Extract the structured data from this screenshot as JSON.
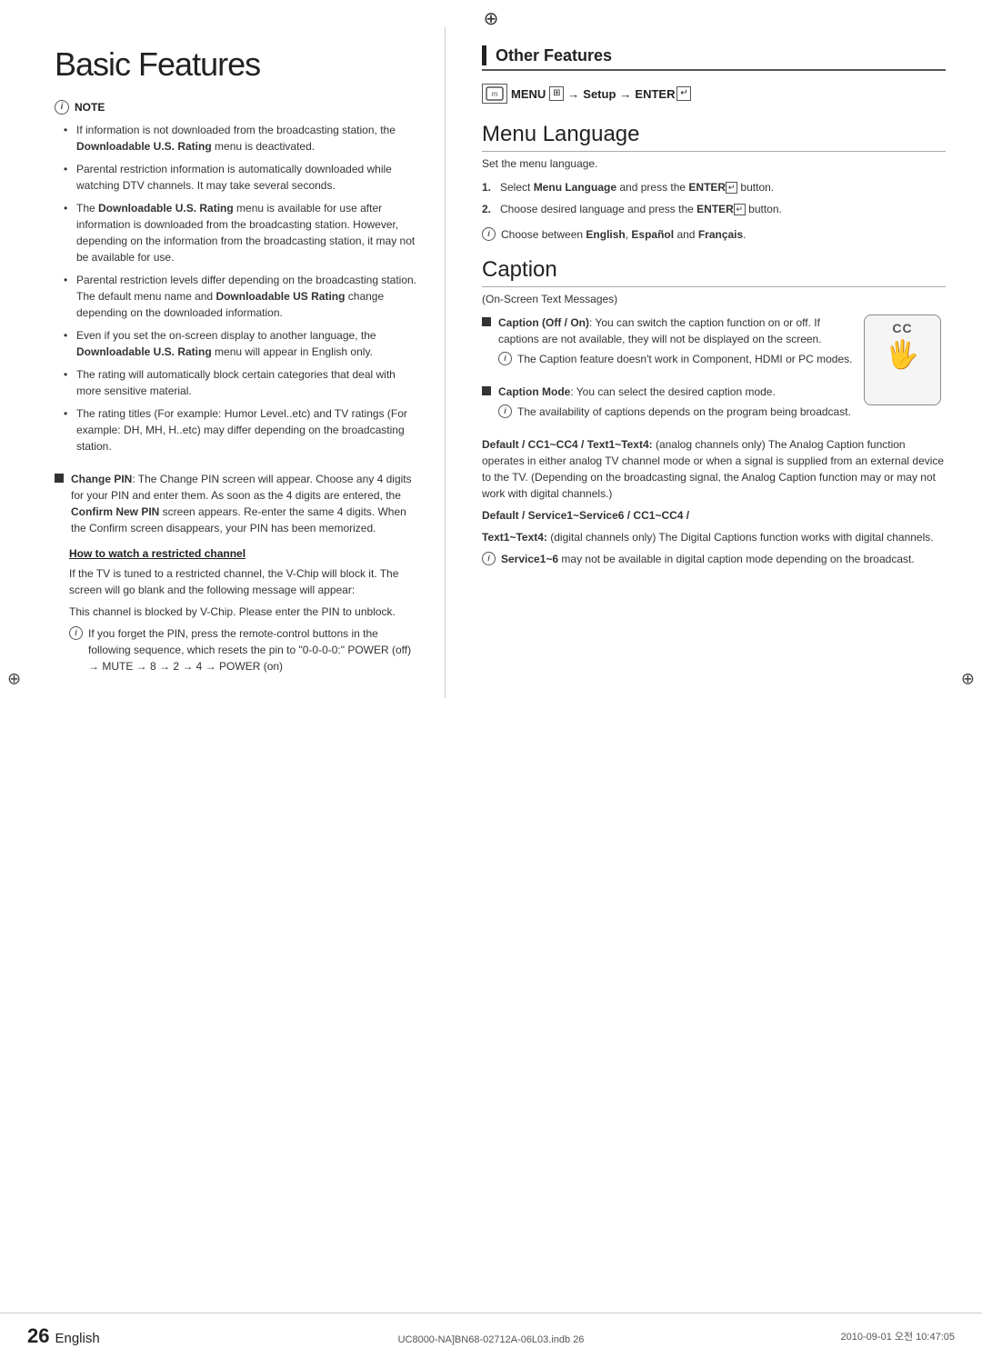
{
  "page": {
    "title": "Basic Features",
    "page_number": "26",
    "language": "English",
    "footer_file": "UC8000-NA]BN68-02712A-06L03.indb   26",
    "footer_date": "2010-09-01   오전  10:47:05"
  },
  "left_column": {
    "note_header": "NOTE",
    "note_bullets": [
      "If information is not downloaded from the broadcasting station, the Downloadable U.S. Rating menu is deactivated.",
      "Parental restriction information is automatically downloaded while watching DTV channels. It may take several seconds.",
      "The Downloadable U.S. Rating menu is available for use after information is downloaded from the broadcasting station. However, depending on the information from the broadcasting station, it may not be available for use.",
      "Parental restriction levels differ depending on the broadcasting station. The default menu name and Downloadable US Rating change depending on the downloaded information.",
      "Even if you set the on-screen display to another language, the Downloadable U.S. Rating menu will appear in English only.",
      "The rating will automatically block certain categories that deal with more sensitive material.",
      "The rating titles (For example: Humor Level..etc) and TV ratings (For example: DH, MH, H..etc) may differ depending on the broadcasting station."
    ],
    "change_pin_label": "Change PIN",
    "change_pin_text": ": The Change PIN screen will appear. Choose any 4 digits for your PIN and enter them. As soon as the 4 digits are entered, the Confirm New PIN screen appears. Re-enter the same 4 digits. When the Confirm screen disappears, your PIN has been memorized.",
    "restricted_channel_heading": "How to watch a restricted channel",
    "restricted_channel_text1": "If the TV is tuned to a restricted channel, the V-Chip will block it. The screen will go blank and the following message will appear:",
    "restricted_channel_text2": "This channel is blocked by V-Chip. Please enter the PIN to unblock.",
    "pin_note_text": "If you forget the PIN, press the remote-control buttons in the following sequence, which resets the pin to \"0-0-0-0:\" POWER (off) → MUTE → 8 → 2 → 4 → POWER (on)"
  },
  "right_column": {
    "other_features_title": "Other Features",
    "menu_path": "MENU",
    "menu_path_arrow1": "→",
    "menu_path_setup": "Setup",
    "menu_path_arrow2": "→",
    "menu_path_enter": "ENTER",
    "menu_language_title": "Menu Language",
    "menu_language_subtitle": "Set the menu language.",
    "step1_text": "Select Menu Language and press the ENTER button.",
    "step2_text": "Choose desired language and press the ENTER button.",
    "choose_note": "Choose between English, Español and Français.",
    "caption_title": "Caption",
    "caption_subtitle": "(On-Screen Text Messages)",
    "caption_off_on_label": "Caption (Off / On)",
    "caption_off_on_text": ": You can switch the caption function on or off. If captions are not available, they will not be displayed on the screen.",
    "caption_feature_note": "The Caption feature doesn't work in Component, HDMI or PC modes.",
    "caption_mode_label": "Caption Mode",
    "caption_mode_text": ": You can select the desired caption mode.",
    "caption_availability_note": "The availability of captions depends on the program being broadcast.",
    "default_cc_text": "Default / CC1~CC4 / Text1~Text4: (analog channels only) The Analog Caption function operates in either analog TV channel mode or when a signal is supplied from an external device to the TV. (Depending on the broadcasting signal, the Analog Caption function may or may not work with digital channels.)",
    "default_service_heading": "Default / Service1~Service6 / CC1~CC4 /",
    "default_service_text": "Text1~Text4: (digital channels only) The Digital Captions function works with digital channels.",
    "service_note": "Service1~6 may not be available in digital caption mode depending on the broadcast.",
    "cc_label": "CC"
  }
}
